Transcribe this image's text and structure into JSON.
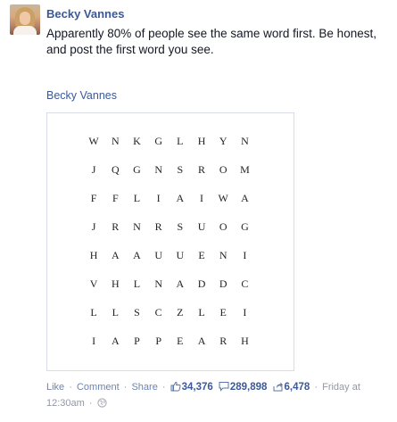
{
  "post": {
    "author": "Becky Vannes",
    "text": "Apparently 80% of people see the same word first. Be honest, and post the first word you see.",
    "shared_from": "Becky Vannes"
  },
  "puzzle": {
    "rows": [
      [
        "W",
        "N",
        "K",
        "G",
        "L",
        "H",
        "Y",
        "N"
      ],
      [
        "J",
        "Q",
        "G",
        "N",
        "S",
        "R",
        "O",
        "M"
      ],
      [
        "F",
        "F",
        "L",
        "I",
        "A",
        "I",
        "W",
        "A"
      ],
      [
        "J",
        "R",
        "N",
        "R",
        "S",
        "U",
        "O",
        "G"
      ],
      [
        "H",
        "A",
        "A",
        "U",
        "U",
        "E",
        "N",
        "I"
      ],
      [
        "V",
        "H",
        "L",
        "N",
        "A",
        "D",
        "D",
        "C"
      ],
      [
        "L",
        "L",
        "S",
        "C",
        "Z",
        "L",
        "E",
        "I"
      ],
      [
        "I",
        "A",
        "P",
        "P",
        "E",
        "A",
        "R",
        "H"
      ]
    ]
  },
  "footer": {
    "like_label": "Like",
    "comment_label": "Comment",
    "share_label": "Share",
    "like_count": "34,376",
    "comment_count": "289,898",
    "share_count": "6,478",
    "timestamp": "Friday at 12:30am",
    "separator": "·",
    "icons": {
      "like": "thumbs-up-icon",
      "comment": "comment-bubble-icon",
      "share": "share-icon",
      "privacy": "globe-icon"
    },
    "colors": {
      "link": "#6d84b4",
      "count": "#3b5998",
      "muted": "#9197a3"
    }
  }
}
